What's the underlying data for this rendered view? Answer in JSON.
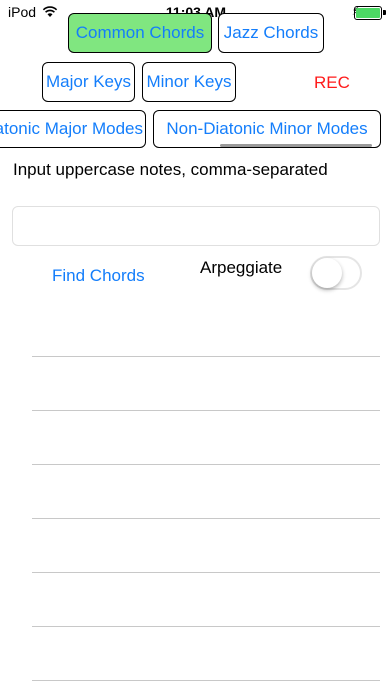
{
  "status_bar": {
    "carrier": "iPod",
    "time": "11:03 AM",
    "wifi_icon": "wifi-icon",
    "battery_icon": "battery-icon",
    "bolt": "⚡"
  },
  "tabs_row1": [
    {
      "label": "Common Chords",
      "active": true
    },
    {
      "label": "Jazz Chords",
      "active": false
    }
  ],
  "tabs_row2": [
    {
      "label": "Major Keys"
    },
    {
      "label": "Minor Keys"
    }
  ],
  "rec_label": "REC",
  "tabs_row3": [
    {
      "label": "Diatonic Major Modes"
    },
    {
      "label": "Non-Diatonic Minor Modes"
    }
  ],
  "instruction": "Input uppercase notes, comma-separated",
  "notes_input": {
    "value": "",
    "placeholder": ""
  },
  "find_label": "Find Chords",
  "arpeggiate_label": "Arpeggiate",
  "arpeggiate_on": false,
  "colors": {
    "accent": "#147efb",
    "active_tab": "#80e680",
    "rec": "#ff1a1a"
  }
}
